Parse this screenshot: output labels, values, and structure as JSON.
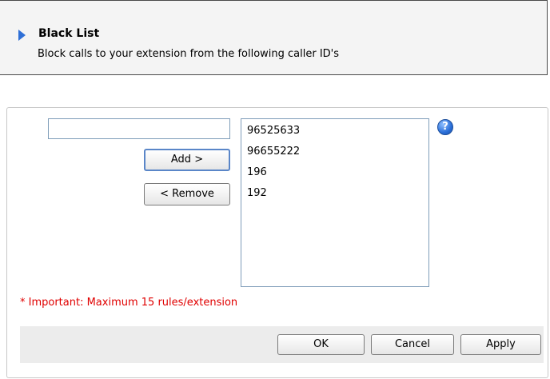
{
  "header": {
    "title": "Black List",
    "description": "Block calls to your extension from the following caller ID's"
  },
  "form": {
    "caller_input_value": "",
    "add_label": "Add >",
    "remove_label": "< Remove",
    "help_glyph": "?",
    "blacklist_items": [
      "96525633",
      "96655222",
      "196",
      "192"
    ],
    "important_note": "* Important: Maximum 15 rules/extension"
  },
  "footer": {
    "ok_label": "OK",
    "cancel_label": "Cancel",
    "apply_label": "Apply"
  },
  "icons": {
    "header_arrow": "triangle-right-icon",
    "help": "help-icon"
  },
  "colors": {
    "accent": "#2f6fd6",
    "important_text": "#e00000",
    "button_bar": "#ececec"
  }
}
